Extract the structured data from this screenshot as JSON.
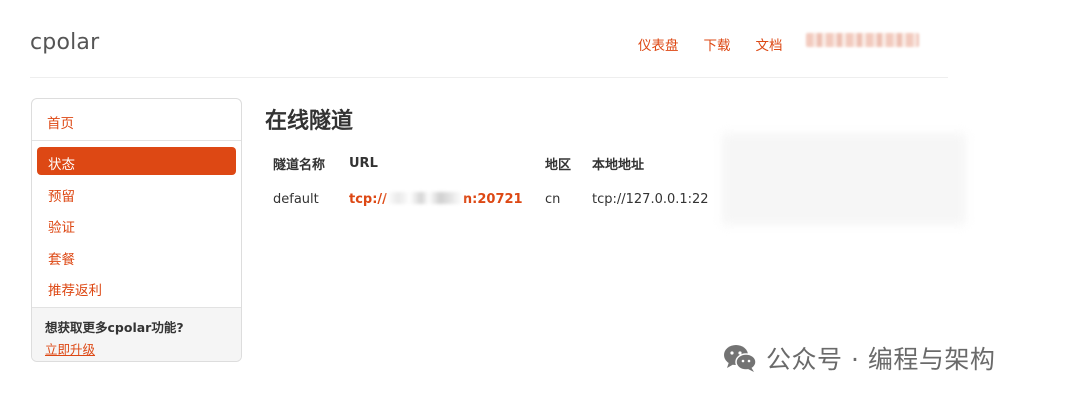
{
  "header": {
    "brand": "cpolar",
    "nav": [
      {
        "label": "仪表盘"
      },
      {
        "label": "下载"
      },
      {
        "label": "文档"
      }
    ]
  },
  "sidebar": {
    "home": "首页",
    "items": [
      {
        "label": "状态",
        "active": true
      },
      {
        "label": "预留",
        "active": false
      },
      {
        "label": "验证",
        "active": false
      },
      {
        "label": "套餐",
        "active": false
      },
      {
        "label": "推荐返利",
        "active": false
      }
    ],
    "upgrade_prompt": "想获取更多cpolar功能?",
    "upgrade_link": "立即升级"
  },
  "main": {
    "title": "在线隧道",
    "table": {
      "headers": [
        "隧道名称",
        "URL",
        "地区",
        "本地地址"
      ],
      "rows": [
        {
          "name": "default",
          "url_prefix": "tcp://",
          "url_suffix": "n:20721",
          "region": "cn",
          "local": "tcp://127.0.0.1:22"
        }
      ]
    }
  },
  "watermark": {
    "text": "公众号 · 编程与架构",
    "icon": "wechat-icon"
  },
  "colors": {
    "accent": "#dd4814",
    "text": "#333333",
    "border": "#dddddd"
  }
}
